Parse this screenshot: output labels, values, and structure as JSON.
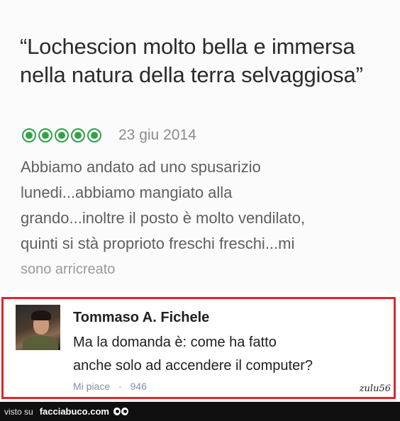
{
  "review": {
    "title": "“Lochescion molto bella e immersa nella natura della terra selvaggiosa”",
    "rating": {
      "value": 5,
      "max": 5,
      "color": "#35a04a"
    },
    "date": "23 giu 2014",
    "body_lines": [
      "Abbiamo andato ad uno spusarizio",
      "lunedi...abbiamo mangiato alla",
      "grando...inoltre il posto è molto vendilato,",
      "quinti si stà proprioto freschi freschi...mi",
      "sono arricreato"
    ]
  },
  "comment": {
    "author": "Tommaso A. Fichele",
    "text_lines": [
      "Ma la domanda è: come ha fatto",
      "anche solo ad accendere il computer?"
    ],
    "like_label": "Mi piace",
    "separator": "·",
    "like_count": "946",
    "highlight_color": "#e3242b"
  },
  "signature": "zulu56",
  "footer": {
    "visto_label": "visto su",
    "site_name": "facciabuco.com",
    "logo_icon": "eyes-icon"
  }
}
